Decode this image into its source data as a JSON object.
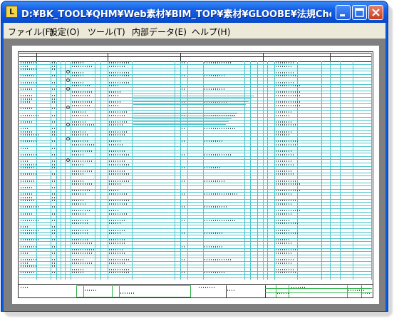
{
  "window": {
    "title": "D:¥BK_TOOL¥QHM¥Web素材¥BIM_TOP¥素材¥GLOOBE¥法規Chec...",
    "app_icon_text": "L"
  },
  "menu": [
    {
      "label": "ファイル(F)"
    },
    {
      "label": "設定(O)"
    },
    {
      "label": "ツール(T)"
    },
    {
      "label": "内部データ(E)"
    },
    {
      "label": "ヘルプ(H)"
    }
  ],
  "colors": {
    "title_blue": "#0b51d7",
    "menu_bg": "#ece9d8",
    "client_bg": "#7f7f7f",
    "grid_cyan": "#4cc4cc",
    "title_block_green": "#2fb54a"
  }
}
